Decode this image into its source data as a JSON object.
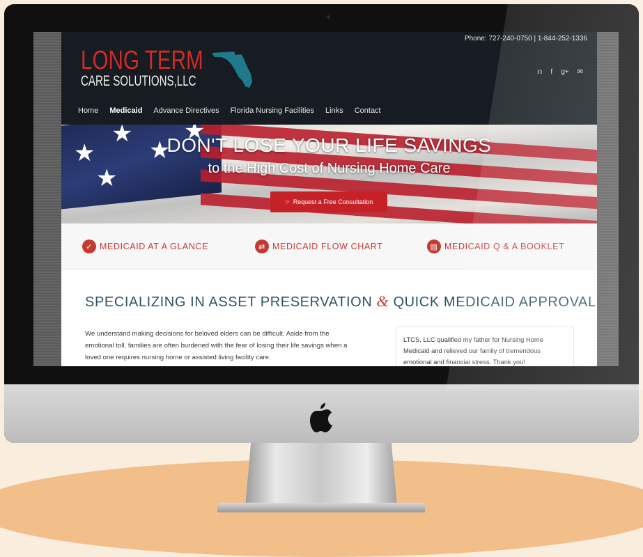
{
  "header": {
    "phone": "Phone: 727-240-0750 | 1-844-252-1336",
    "logo_line1": "LONG TERM",
    "logo_line2": "CARE SOLUTIONS,LLC",
    "social": [
      "twitter-icon",
      "facebook-icon",
      "google-plus-icon",
      "mail-icon"
    ]
  },
  "nav": {
    "items": [
      "Home",
      "Medicaid",
      "Advance Directives",
      "Florida Nursing Facilities",
      "Links",
      "Contact"
    ],
    "active": "Medicaid"
  },
  "hero": {
    "title": "DON'T LOSE YOUR LIFE SAVINGS",
    "subtitle": "to the High Cost of Nursing Home Care",
    "cta_label": "Request a Free Consultation"
  },
  "features": [
    {
      "label": "MEDICAID AT A GLANCE",
      "icon": "check-circle-icon"
    },
    {
      "label": "MEDICAID FLOW CHART",
      "icon": "flow-chart-icon"
    },
    {
      "label": "MEDICAID Q & A BOOKLET",
      "icon": "booklet-icon"
    }
  ],
  "content": {
    "headline_part1": "SPECIALIZING IN ASSET PRESERVATION",
    "headline_amp": "&",
    "headline_part2": "QUICK MEDICAID APPROVALS",
    "body": "We understand making decisions for beloved elders can be difficult. Aside from the emotional toll, families are often burdened with the fear of losing their life savings when a loved one requires nursing home or assisted living facility care.",
    "testimonial": "LTCS, LLC qualified my father for Nursing Home Medicaid and relieved our family of tremendous emotional and financial stress. Thank you!"
  },
  "colors": {
    "brand_red": "#c33a32",
    "header_bg": "#161c21",
    "headline_teal": "#2d5464",
    "background": "#f9eddd",
    "floor": "#f2be8a"
  }
}
